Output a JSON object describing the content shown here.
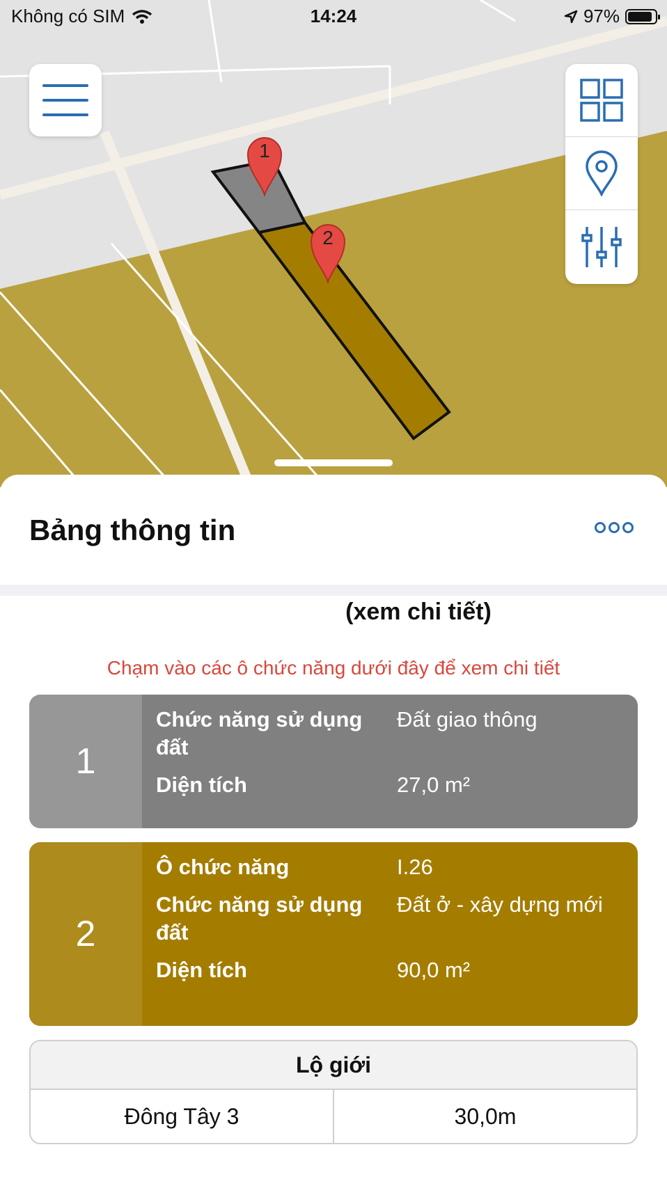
{
  "status_bar": {
    "carrier": "Không có SIM",
    "time": "14:24",
    "battery": "97%"
  },
  "icons": {
    "menu": "hamburger-icon",
    "layers": "grid-icon",
    "location": "location-pin-icon",
    "filters": "sliders-icon",
    "more": "more-dots-icon"
  },
  "map": {
    "markers": [
      {
        "label": "1"
      },
      {
        "label": "2"
      }
    ],
    "colors": {
      "road_area": "#e3e3e3",
      "residential_land": "#b9a13f",
      "selected_transport": "#858585",
      "selected_residential": "#a47d00"
    }
  },
  "sheet": {
    "title": "Bảng thông tin",
    "detail_link": "(xem chi tiết)",
    "hint": "Chạm vào các ô chức năng dưới đây để xem chi tiết",
    "parcels": [
      {
        "number": "1",
        "color": "#808080",
        "rows": [
          {
            "label": "Chức năng sử dụng đất",
            "value": "Đất giao thông"
          },
          {
            "label": "Diện tích",
            "value": "27,0 m²"
          }
        ]
      },
      {
        "number": "2",
        "color": "#a47d00",
        "rows": [
          {
            "label": "Ô chức năng",
            "value": "I.26"
          },
          {
            "label": "Chức năng sử dụng đất",
            "value": "Đất ở - xây dựng mới"
          },
          {
            "label": "Diện tích",
            "value": "90,0 m²"
          }
        ]
      }
    ],
    "road_table": {
      "header": "Lộ giới",
      "rows": [
        {
          "name": "Đông Tây 3",
          "width": "30,0m"
        }
      ]
    }
  }
}
